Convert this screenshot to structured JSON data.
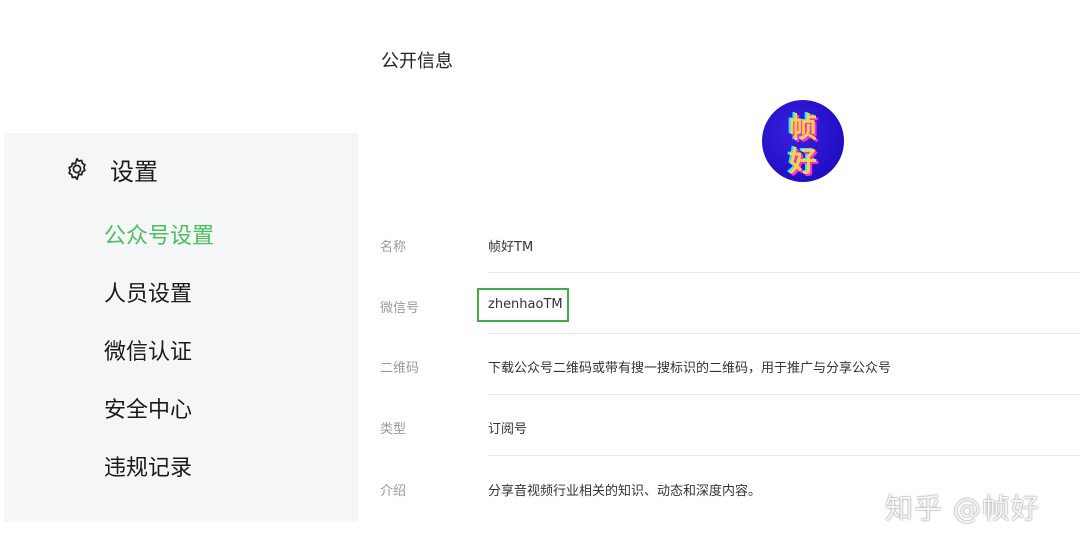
{
  "sidebar": {
    "title": "设置",
    "icon": "gear-icon",
    "items": [
      {
        "label": "公众号设置",
        "active": true
      },
      {
        "label": "人员设置"
      },
      {
        "label": "微信认证"
      },
      {
        "label": "安全中心"
      },
      {
        "label": "违规记录"
      }
    ]
  },
  "main": {
    "section_title": "公开信息",
    "avatar_text": [
      "帧",
      "好"
    ],
    "rows": [
      {
        "label": "名称",
        "value": "帧好TM"
      },
      {
        "label": "微信号",
        "value": "zhenhaoTM",
        "highlighted": true
      },
      {
        "label": "二维码",
        "value": "下载公众号二维码或带有搜一搜标识的二维码，用于推广与分享公众号"
      },
      {
        "label": "类型",
        "value": "订阅号"
      },
      {
        "label": "介绍",
        "value": "分享音视频行业相关的知识、动态和深度内容。"
      }
    ]
  },
  "watermark": "知乎 @帧好",
  "colors": {
    "accent": "#4bbf5c",
    "highlight_border": "#3fae49",
    "sidebar_bg": "#f5f6f7",
    "avatar_bg": "#1608b8"
  }
}
